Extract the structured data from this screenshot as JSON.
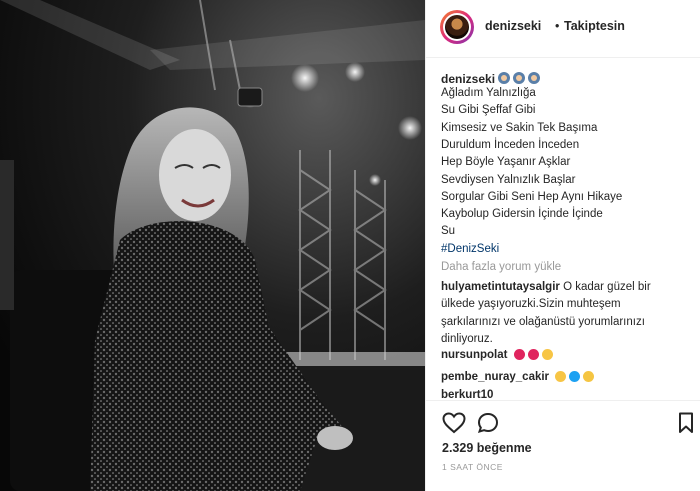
{
  "post": {
    "username": "denizseki",
    "follow_dot": "•",
    "follow_label": "Takiptesin"
  },
  "caption": {
    "username": "denizseki",
    "emoji_icons": [
      "woman-icon",
      "woman-icon",
      "woman-icon"
    ],
    "lines": [
      "Ağladım Yalnızlığa",
      "Su Gibi Şeffaf Gibi",
      "Kimsesiz ve Sakin Tek Başıma",
      "Duruldum İnceden İnceden",
      "Hep Böyle Yaşanır Aşklar",
      "Sevdiysen Yalnızlık Başlar",
      "Sorgular Gibi Seni Hep Aynı Hikaye",
      "Kaybolup Gidersin İçinde İçinde",
      "Su"
    ],
    "hashtag": "#DenizSeki"
  },
  "load_more": "Daha fazla yorum yükle",
  "comments": [
    {
      "username": "hulyametintutaysalgir",
      "lines": [
        "O kadar güzel bir",
        "ülkede yaşıyoruzki.Sizin muhteşem",
        "şarkılarınızı ve olağanüstü yorumlarınızı",
        "dinliyoruz."
      ]
    },
    {
      "username": "nursunpolat",
      "emoji_icons": [
        "red-heart-icon",
        "red-heart-icon",
        "smiling-face-icon"
      ]
    },
    {
      "username": "pembe_nuray_cakir",
      "emoji_icons": [
        "smiling-face-icon",
        "blue-heart-icon",
        "yellow-heart-icon"
      ]
    },
    {
      "username": "berkurt10",
      "text": ""
    }
  ],
  "actions": {
    "icons": [
      "heart-icon",
      "comment-icon",
      "bookmark-icon"
    ],
    "likes": "2.329 beğenme",
    "time": "1 SAAT ÖNCE"
  }
}
